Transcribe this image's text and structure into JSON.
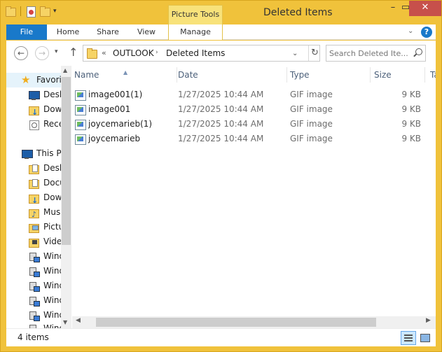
{
  "window": {
    "title": "Deleted Items",
    "contextual_tab": "Picture Tools",
    "minimize_glyph": "–",
    "maximize_glyph": "▭",
    "close_glyph": "✕"
  },
  "ribbon": {
    "tabs": [
      "File",
      "Home",
      "Share",
      "View",
      "Manage"
    ],
    "help_glyph": "?",
    "collapse_glyph": "⌄"
  },
  "address": {
    "overflow": "«",
    "crumbs": [
      "OUTLOOK",
      "Deleted Items"
    ],
    "separator": "›",
    "dropdown_glyph": "⌄",
    "refresh_glyph": "↻"
  },
  "search": {
    "placeholder": "Search Deleted Ite..."
  },
  "nav": {
    "back_glyph": "←",
    "forward_glyph": "→",
    "recent_glyph": "▾",
    "up_glyph": "↑",
    "items": [
      {
        "label": "Favorites",
        "icon": "star-icon"
      },
      {
        "label": "Desktop",
        "icon": "desktop-icon"
      },
      {
        "label": "Downloads",
        "icon": "downloads-folder-icon"
      },
      {
        "label": "Recent places",
        "icon": "recent-places-icon"
      },
      {
        "label": "This PC",
        "icon": "computer-icon"
      },
      {
        "label": "Desktop",
        "icon": "desktop-folder-icon"
      },
      {
        "label": "Documents",
        "icon": "documents-folder-icon"
      },
      {
        "label": "Downloads",
        "icon": "downloads-folder-icon"
      },
      {
        "label": "Music",
        "icon": "music-folder-icon"
      },
      {
        "label": "Pictures",
        "icon": "pictures-folder-icon"
      },
      {
        "label": "Videos",
        "icon": "videos-folder-icon"
      },
      {
        "label": "Windows",
        "icon": "network-drive-icon"
      },
      {
        "label": "Windows",
        "icon": "network-drive-icon"
      },
      {
        "label": "Windows",
        "icon": "network-drive-icon"
      },
      {
        "label": "Windows",
        "icon": "network-drive-icon"
      },
      {
        "label": "Windows",
        "icon": "network-drive-icon"
      },
      {
        "label": "Windows",
        "icon": "network-drive-icon"
      }
    ]
  },
  "columns": [
    "Name",
    "Date",
    "Type",
    "Size",
    "Tags"
  ],
  "files": [
    {
      "name": "image001(1)",
      "date": "1/27/2025 10:44 AM",
      "type": "GIF image",
      "size": "9 KB"
    },
    {
      "name": "image001",
      "date": "1/27/2025 10:44 AM",
      "type": "GIF image",
      "size": "9 KB"
    },
    {
      "name": "joycemarieb(1)",
      "date": "1/27/2025 10:44 AM",
      "type": "GIF image",
      "size": "9 KB"
    },
    {
      "name": "joycemarieb",
      "date": "1/27/2025 10:44 AM",
      "type": "GIF image",
      "size": "9 KB"
    }
  ],
  "status": {
    "item_count": "4 items"
  },
  "colors": {
    "accent": "#1979ca",
    "frame": "#f0c23b",
    "close": "#c7504b"
  }
}
